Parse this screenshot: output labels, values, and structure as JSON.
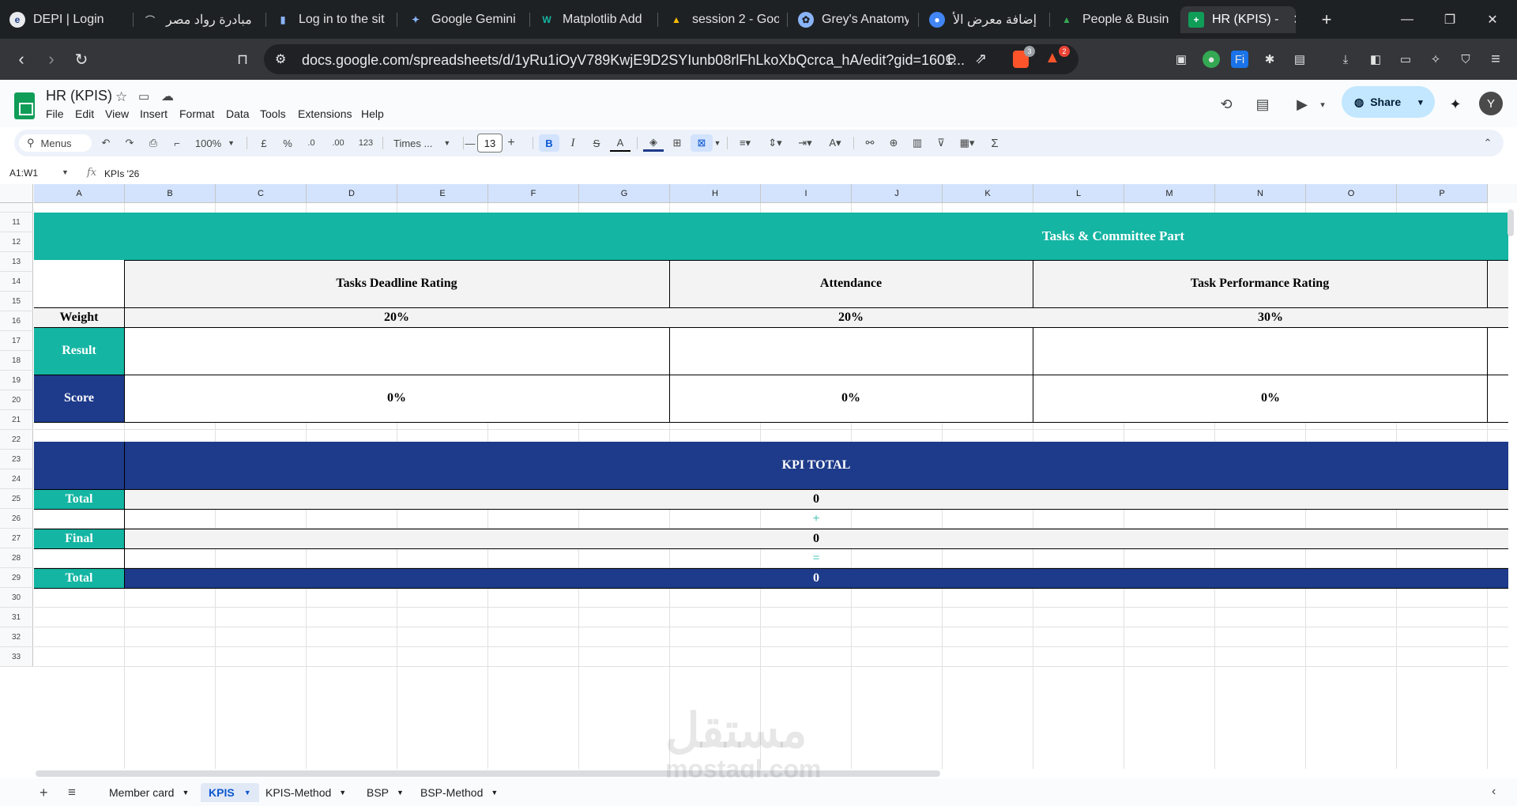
{
  "browser": {
    "tabs": [
      {
        "title": "DEPI | Login",
        "icon": "depi-icon"
      },
      {
        "title": "مبادرة رواد مصر",
        "icon": "rowad-icon"
      },
      {
        "title": "Log in to the sit",
        "icon": "login-icon"
      },
      {
        "title": "Google Gemini",
        "icon": "gemini-icon"
      },
      {
        "title": "Matplotlib Add",
        "icon": "matplotlib-icon"
      },
      {
        "title": "session 2 - Goo",
        "icon": "drive-icon"
      },
      {
        "title": "Grey's Anatomy",
        "icon": "film-icon"
      },
      {
        "title": "إضافة معرض الأ",
        "icon": "circle-icon"
      },
      {
        "title": "People & Busin",
        "icon": "drive-icon"
      },
      {
        "title": "HR (KPIS) -",
        "icon": "sheets-icon",
        "active": true
      }
    ],
    "url": "docs.google.com/spreadsheets/d/1yRu1iOyV789KwjE9D2SYIunb08rlFhLkoXbQcrca_hA/edit?gid=1601...",
    "brave_badge": "3",
    "alert_badge": "2"
  },
  "doc": {
    "title": "HR (KPIS)",
    "menu": [
      "File",
      "Edit",
      "View",
      "Insert",
      "Format",
      "Data",
      "Tools",
      "Extensions",
      "Help"
    ],
    "share_label": "Share",
    "avatar_letter": "Y"
  },
  "toolbar": {
    "search_label": "Menus",
    "zoom": "100%",
    "currency": "£",
    "percent": "%",
    "dec_decrease": ".0",
    "dec_increase": ".00",
    "number_format": "123",
    "font": "Times ...",
    "font_size": "13",
    "bold": "B",
    "italic": "I",
    "text_color": "A",
    "sum": "Σ"
  },
  "formula_bar": {
    "name_box": "A1:W1",
    "fx": "fx",
    "content": "KPIs '26"
  },
  "columns": [
    "A",
    "B",
    "C",
    "D",
    "E",
    "F",
    "G",
    "H",
    "I",
    "J",
    "K",
    "L",
    "M",
    "N",
    "O",
    "P"
  ],
  "rows": [
    "11",
    "12",
    "13",
    "14",
    "15",
    "16",
    "17",
    "18",
    "19",
    "20",
    "21",
    "22",
    "23",
    "24",
    "25",
    "26",
    "27",
    "28",
    "29",
    "30",
    "31",
    "32",
    "33"
  ],
  "sheet": {
    "section_title": "Tasks & Committee Part",
    "headers": [
      "Tasks Deadline Rating",
      "Attendance",
      "Task Performance Rating"
    ],
    "weight_label": "Weight",
    "weights": [
      "20%",
      "20%",
      "30%"
    ],
    "result_label": "Result",
    "score_label": "Score",
    "scores": [
      "0%",
      "0%",
      "0%"
    ],
    "kpi_total_title": "KPI TOTAL",
    "total_label": "Total",
    "total_value": "0",
    "plus_sign": "+",
    "final_label": "Final",
    "final_value": "0",
    "equals_sign": "=",
    "grand_total_label": "Total",
    "grand_total_value": "0"
  },
  "sheet_tabs": [
    "Member card",
    "KPIS",
    "KPIS-Method",
    "BSP",
    "BSP-Method"
  ],
  "active_sheet": "KPIS",
  "watermark": {
    "line1": "مستقل",
    "line2": "mostaql.com"
  },
  "colors": {
    "teal": "#14b5a3",
    "navy": "#1e3a8a",
    "light_gray": "#f3f3f3"
  }
}
